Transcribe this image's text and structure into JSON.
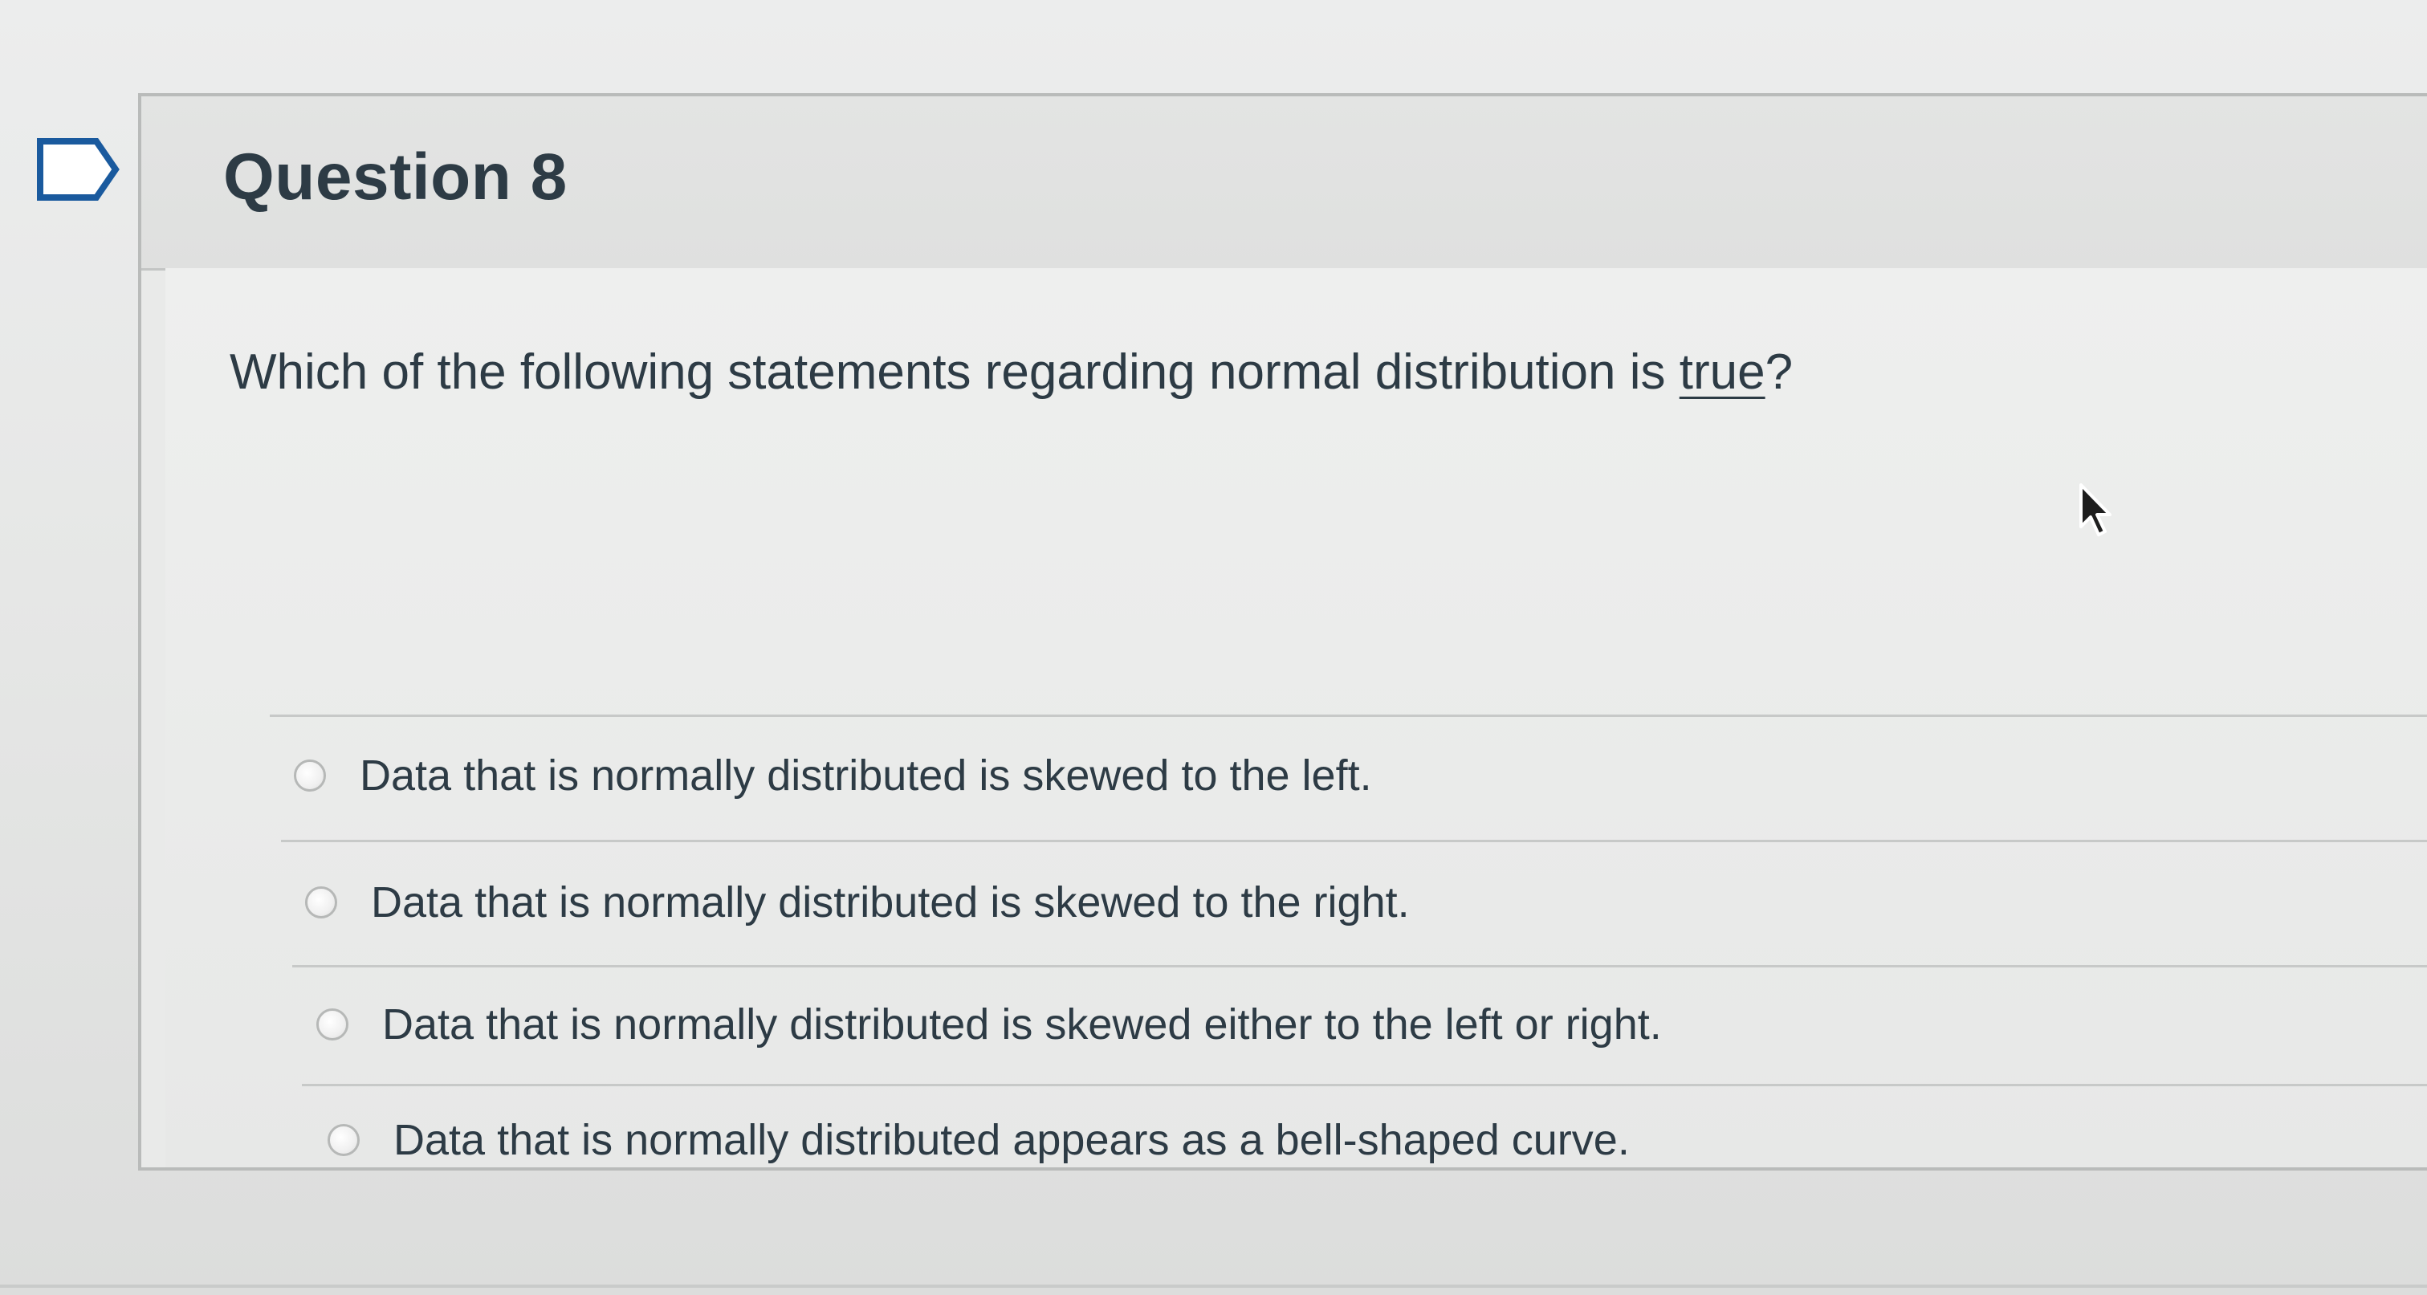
{
  "question": {
    "title": "Question 8",
    "text_before": "Which of the following statements regarding normal distribution is ",
    "text_emphasis": "true",
    "text_after": "?"
  },
  "answers": [
    {
      "label": "Data that is normally distributed is skewed to the left."
    },
    {
      "label": "Data that is normally distributed is skewed to the right."
    },
    {
      "label": "Data that is normally distributed is skewed either to the left or right."
    },
    {
      "label": "Data that is normally distributed appears as a bell-shaped curve."
    }
  ],
  "icons": {
    "flag": "bookmark-flag-icon",
    "cursor": "mouse-pointer-icon"
  },
  "colors": {
    "text": "#2d3b45",
    "border": "#b9bbba",
    "flag_stroke": "#1a5a9e"
  }
}
